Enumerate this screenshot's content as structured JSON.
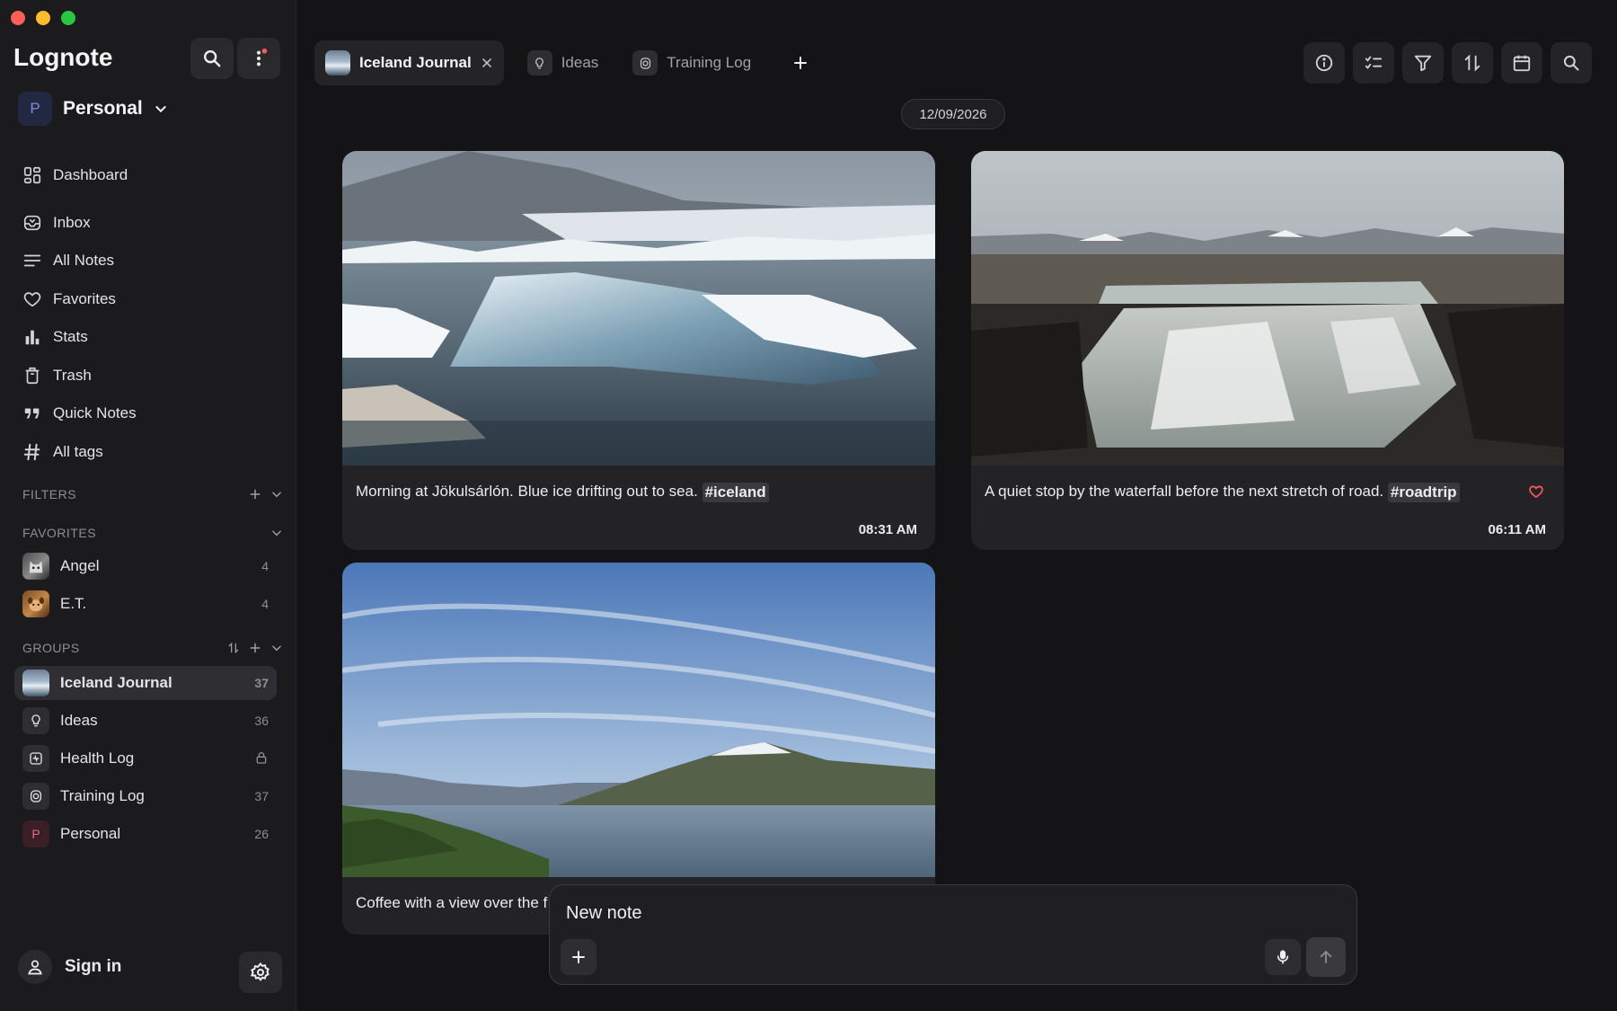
{
  "app": {
    "title": "Lognote"
  },
  "workspace": {
    "avatar_letter": "P",
    "name": "Personal"
  },
  "nav": [
    {
      "label": "Dashboard",
      "icon": "dashboard-icon"
    },
    {
      "label": "Inbox",
      "icon": "inbox-icon"
    },
    {
      "label": "All Notes",
      "icon": "list-icon"
    },
    {
      "label": "Favorites",
      "icon": "heart-icon"
    },
    {
      "label": "Stats",
      "icon": "bar-chart-icon"
    },
    {
      "label": "Trash",
      "icon": "trash-icon"
    },
    {
      "label": "Quick Notes",
      "icon": "quote-icon"
    },
    {
      "label": "All tags",
      "icon": "hash-icon"
    }
  ],
  "sections": {
    "filters": "FILTERS",
    "favorites": "FAVORITES",
    "groups": "GROUPS"
  },
  "favorites": [
    {
      "name": "Angel",
      "count": "4"
    },
    {
      "name": "E.T.",
      "count": "4"
    }
  ],
  "groups": [
    {
      "name": "Iceland Journal",
      "count": "37",
      "icon": "photo-thumb-icon",
      "active": true
    },
    {
      "name": "Ideas",
      "count": "36",
      "icon": "lightbulb-icon"
    },
    {
      "name": "Health Log",
      "count": "",
      "icon": "heartbeat-icon",
      "locked": true
    },
    {
      "name": "Training Log",
      "count": "37",
      "icon": "stopwatch-icon"
    },
    {
      "name": "Personal",
      "count": "26",
      "icon": "letter-p-icon",
      "letter": "P"
    }
  ],
  "footer": {
    "signin_label": "Sign in"
  },
  "tabs": [
    {
      "label": "Iceland Journal",
      "active": true
    },
    {
      "label": "Ideas"
    },
    {
      "label": "Training Log"
    }
  ],
  "toolbar_icons": [
    "info-icon",
    "checklist-icon",
    "filter-icon",
    "sort-icon",
    "calendar-icon",
    "search-icon"
  ],
  "date_pill": "12/09/2026",
  "notes": [
    {
      "text": "Morning at Jökulsárlón. Blue ice drifting out to sea.",
      "tag": "#iceland",
      "time": "08:31 AM",
      "favorite": false
    },
    {
      "text": "A quiet stop by the waterfall before the next stretch of road.",
      "tag": "#roadtrip",
      "time": "06:11 AM",
      "favorite": true
    },
    {
      "text": "Coffee with a view over the f",
      "tag": "",
      "time": "",
      "favorite": false
    }
  ],
  "composer": {
    "placeholder": "New note"
  },
  "colors": {
    "accent_heart": "#ff5a5f",
    "notification_dot": "#ff5a5f",
    "background": "#141416",
    "sidebar": "#1b1b1d"
  }
}
